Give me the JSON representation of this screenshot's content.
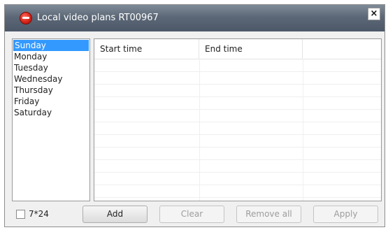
{
  "window": {
    "title": "Local video plans RT00967",
    "close_label": "×"
  },
  "days": [
    {
      "label": "Sunday",
      "selected": true
    },
    {
      "label": "Monday",
      "selected": false
    },
    {
      "label": "Tuesday",
      "selected": false
    },
    {
      "label": "Wednesday",
      "selected": false
    },
    {
      "label": "Thursday",
      "selected": false
    },
    {
      "label": "Friday",
      "selected": false
    },
    {
      "label": "Saturday",
      "selected": false
    }
  ],
  "table": {
    "columns": [
      "Start time",
      "End time",
      ""
    ],
    "rows": []
  },
  "footer": {
    "checkbox_label": "7*24",
    "checkbox_checked": false,
    "add": "Add",
    "clear": "Clear",
    "remove_all": "Remove all",
    "apply": "Apply"
  },
  "colors": {
    "selection": "#3399ff",
    "titlebar": "#5c6877"
  }
}
